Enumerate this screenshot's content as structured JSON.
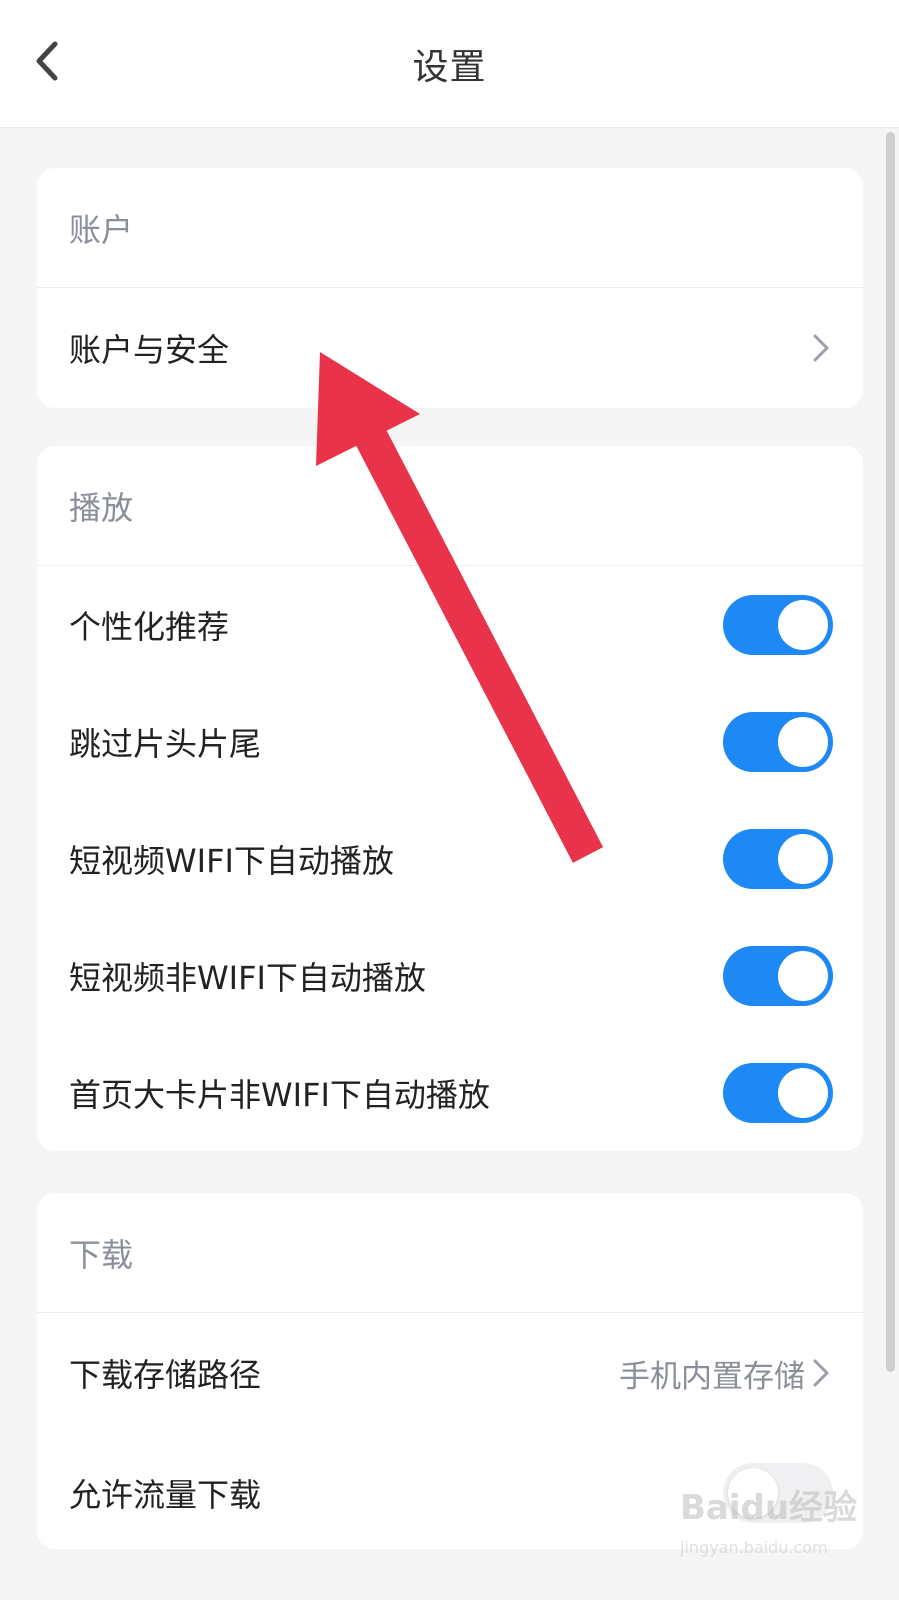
{
  "header": {
    "title": "设置"
  },
  "account": {
    "title": "账户",
    "items": [
      {
        "label": "账户与安全"
      }
    ]
  },
  "playback": {
    "title": "播放",
    "items": [
      {
        "label": "个性化推荐",
        "toggle": "on"
      },
      {
        "label": "跳过片头片尾",
        "toggle": "on"
      },
      {
        "label": "短视频WIFI下自动播放",
        "toggle": "on"
      },
      {
        "label": "短视频非WIFI下自动播放",
        "toggle": "on"
      },
      {
        "label": "首页大卡片非WIFI下自动播放",
        "toggle": "on"
      }
    ]
  },
  "download": {
    "title": "下载",
    "items": [
      {
        "label": "下载存储路径",
        "value": "手机内置存储"
      },
      {
        "label": "允许流量下载",
        "toggle": "off"
      }
    ]
  },
  "colors": {
    "accent": "#1e88f5",
    "arrow": "#e8334a"
  },
  "icons": {
    "back": "chevron-left-icon",
    "next": "chevron-right-icon"
  },
  "watermark": {
    "logo": "Baidu经验",
    "url": "jingyan.baidu.com"
  }
}
